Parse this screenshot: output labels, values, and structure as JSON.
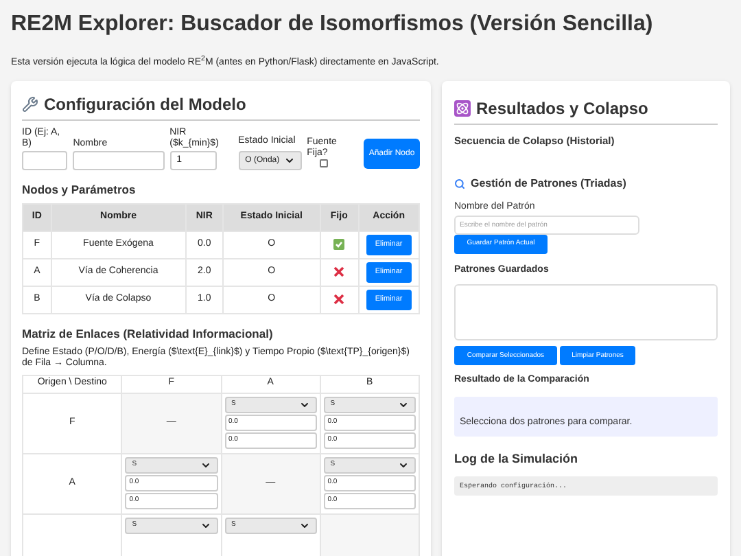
{
  "title": "RE2M Explorer: Buscador de Isomorfismos (Versión Sencilla)",
  "intro": "Esta versión ejecuta la lógica del modelo RE$^{2}$M (antes en Python/Flask) directamente en JavaScript.",
  "config": {
    "heading": "Configuración del Modelo",
    "form": {
      "id_label": "ID (Ej: A, B)",
      "name_label": "Nombre",
      "nir_label": "NIR ($k_{min}$)",
      "nir_value": "1",
      "state_label": "Estado Inicial",
      "state_value": "O (Onda)",
      "fixed_label": "Fuente Fija?",
      "fixed_checked": false,
      "add_button": "Añadir Nodo"
    },
    "nodes_heading": "Nodos y Parámetros",
    "nodes_columns": [
      "ID",
      "Nombre",
      "NIR",
      "Estado Inicial",
      "Fijo",
      "Acción"
    ],
    "nodes": [
      {
        "id": "F",
        "name": "Fuente Exógena",
        "nir": "0.0",
        "state": "O",
        "fixed": true,
        "action": "Eliminar"
      },
      {
        "id": "A",
        "name": "Vía de Coherencia",
        "nir": "2.0",
        "state": "O",
        "fixed": false,
        "action": "Eliminar"
      },
      {
        "id": "B",
        "name": "Vía de Colapso",
        "nir": "1.0",
        "state": "O",
        "fixed": false,
        "action": "Eliminar"
      }
    ],
    "matrix_heading": "Matriz de Enlaces (Relatividad Informacional)",
    "matrix_description": "Define Estado (P/O/D/B), Energía ($\\text{E}_{link}$) y Tiempo Propio ($\\text{TP}_{origen}$) de Fila → Columna.",
    "matrix_columns": [
      "Origen \\ Destino",
      "F",
      "A",
      "B"
    ],
    "matrix_rows": [
      {
        "origin": "F",
        "cells": [
          {
            "kind": "self",
            "text": "—"
          },
          {
            "kind": "link",
            "state": "S",
            "energy": "0.0",
            "tp": "0.0"
          },
          {
            "kind": "link",
            "state": "S",
            "energy": "0.0",
            "tp": "0.0"
          }
        ]
      },
      {
        "origin": "A",
        "cells": [
          {
            "kind": "link",
            "state": "S",
            "energy": "0.0",
            "tp": "0.0"
          },
          {
            "kind": "self",
            "text": "—"
          },
          {
            "kind": "link",
            "state": "S",
            "energy": "0.0",
            "tp": "0.0"
          }
        ]
      },
      {
        "cells": [
          {
            "kind": "link",
            "state": "S"
          },
          {
            "kind": "link",
            "state": "S"
          },
          {
            "kind": "self"
          }
        ]
      }
    ]
  },
  "results": {
    "heading": "Resultados y Colapso",
    "sequence_heading": "Secuencia de Colapso (Historial)",
    "patterns_heading": "Gestión de Patrones (Triadas)",
    "pattern_name_label": "Nombre del Patrón",
    "pattern_name_placeholder": "Escribe el nombre del patrón",
    "save_button": "Guardar Patrón Actual",
    "saved_heading": "Patrones Guardados",
    "compare_button": "Comparar Seleccionados",
    "clear_button": "Limpiar Patrones",
    "comparison_heading": "Resultado de la Comparación",
    "comparison_text": "Selecciona dos patrones para comparar.",
    "log_heading": "Log de la Simulación",
    "log_text": "Esperando configuración..."
  }
}
